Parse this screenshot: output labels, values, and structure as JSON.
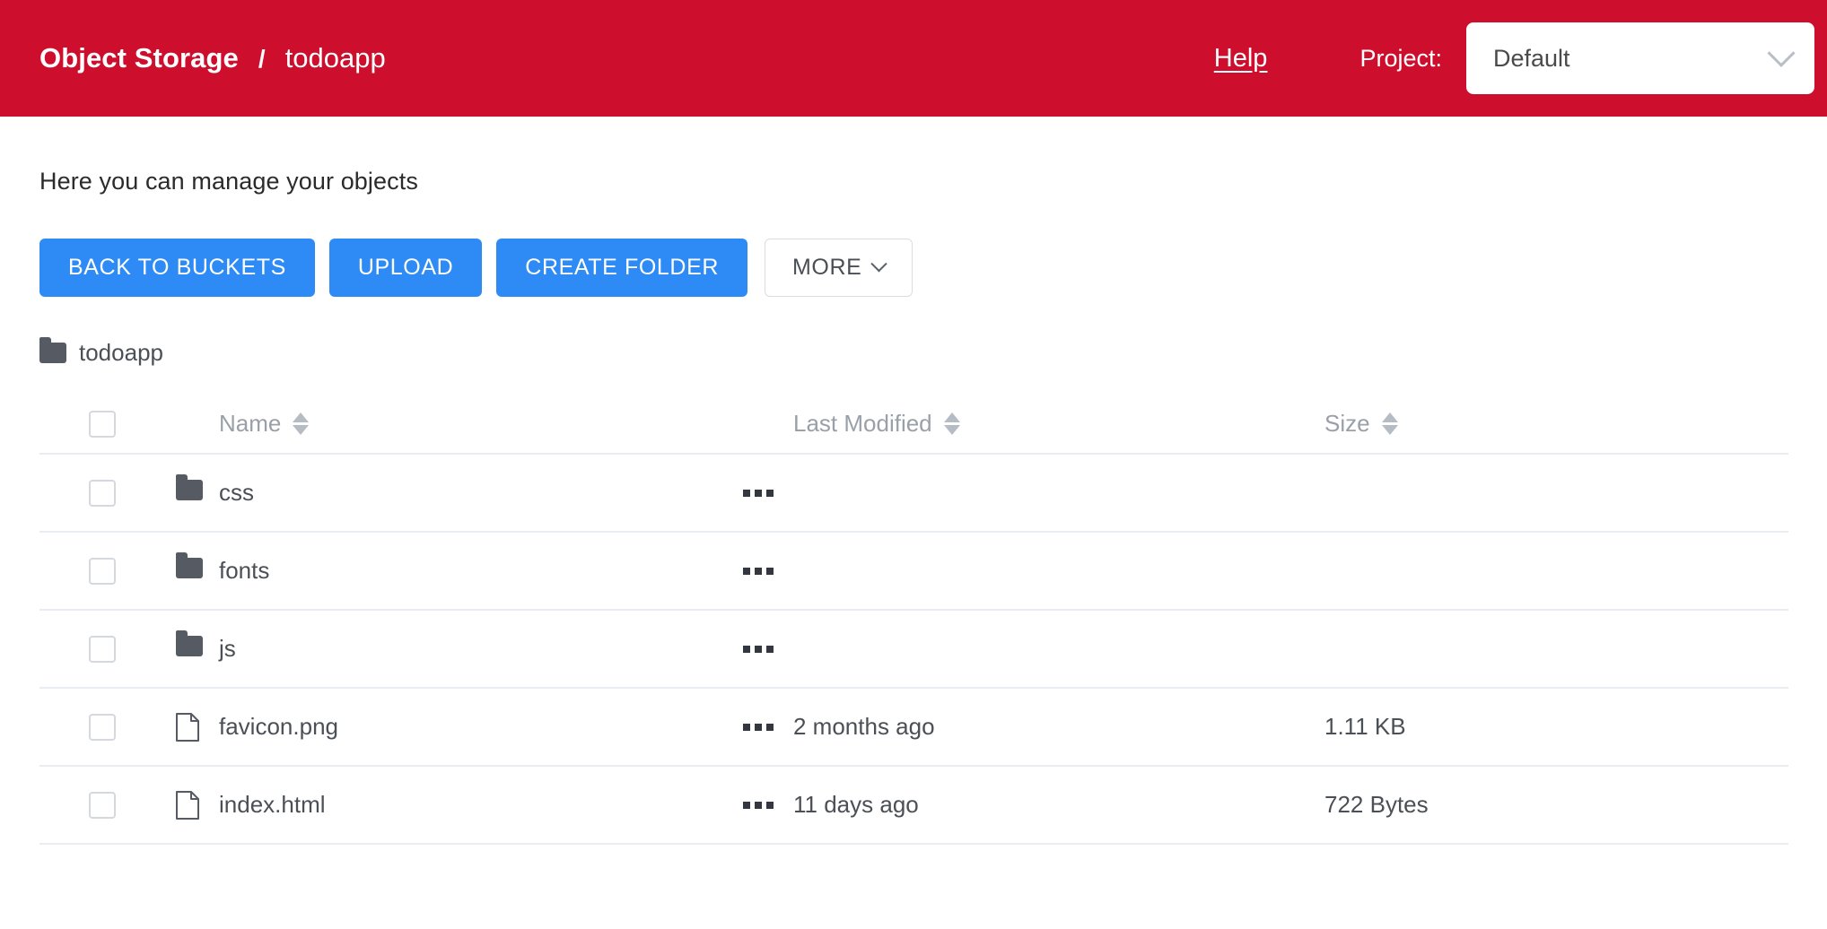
{
  "header": {
    "app_title": "Object Storage",
    "separator": "/",
    "bucket": "todoapp",
    "help_label": "Help",
    "project_label": "Project:",
    "project_value": "Default",
    "brand_color": "#ce0e2d",
    "chevron_icon": "chevron-down-icon"
  },
  "main": {
    "subtitle": "Here you can manage your objects",
    "buttons": {
      "back_to_buckets": "BACK TO BUCKETS",
      "upload": "UPLOAD",
      "create_folder": "CREATE FOLDER",
      "more": "MORE",
      "primary_color": "#2e8bf5"
    },
    "breadcrumb_folder": {
      "icon": "folder-icon",
      "label": "todoapp"
    },
    "table": {
      "columns": {
        "name": "Name",
        "last_modified": "Last Modified",
        "size": "Size"
      },
      "rows": [
        {
          "icon": "folder-icon",
          "name": "css",
          "last_modified": "",
          "size": ""
        },
        {
          "icon": "folder-icon",
          "name": "fonts",
          "last_modified": "",
          "size": ""
        },
        {
          "icon": "folder-icon",
          "name": "js",
          "last_modified": "",
          "size": ""
        },
        {
          "icon": "file-icon",
          "name": "favicon.png",
          "last_modified": "2 months ago",
          "size": "1.11 KB"
        },
        {
          "icon": "file-icon",
          "name": "index.html",
          "last_modified": "11 days ago",
          "size": "722 Bytes"
        }
      ]
    }
  }
}
